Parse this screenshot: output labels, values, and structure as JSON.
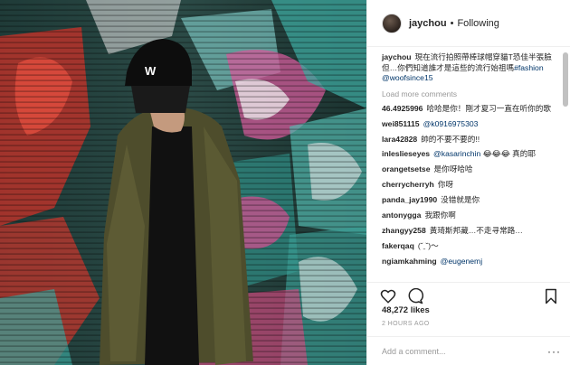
{
  "header": {
    "username": "jaychou",
    "separator": "•",
    "follow_status": "Following"
  },
  "caption": {
    "username": "jaychou",
    "text": "現在流行拍照帶棒球帽穿貓T恐佳半張臉 但…你們知道誰才是這些的流行始祖嗎",
    "hashtag": "#fashion",
    "mention": "@woofsince15"
  },
  "load_more": "Load more comments",
  "comments": [
    {
      "username": "46.4925996",
      "text": "哈哈是你！剛才夏习一直在听你的歌"
    },
    {
      "username": "wei851115",
      "text": "",
      "mention": "@k0916975303"
    },
    {
      "username": "lara42828",
      "text": "帥的不要不要的!!"
    },
    {
      "username": "inleslieseyes",
      "text": "😂😂😂 真的耶",
      "mention": "@kasarinchin"
    },
    {
      "username": "orangetsetse",
      "text": "是你呀哈哈"
    },
    {
      "username": "cherrycherryh",
      "text": "你呀"
    },
    {
      "username": "panda_jay1990",
      "text": "没错就是你"
    },
    {
      "username": "antonygga",
      "text": "我跟你啊"
    },
    {
      "username": "zhangyy258",
      "text": "黃琦斯邦藏…不走寻常路…"
    },
    {
      "username": "fakerqaq",
      "text": "(ˇˍˇ)～"
    },
    {
      "username": "ngiamkahming",
      "text": "",
      "mention": "@eugenemj"
    }
  ],
  "actions": {
    "like_icon": "heart-icon",
    "comment_icon": "comment-bubble-icon",
    "save_icon": "bookmark-icon"
  },
  "likes": "48,272 likes",
  "time_ago": "2 HOURS AGO",
  "add_comment": {
    "placeholder": "Add a comment..."
  },
  "more_options": "···",
  "photo": {
    "cap_letter": "W"
  }
}
